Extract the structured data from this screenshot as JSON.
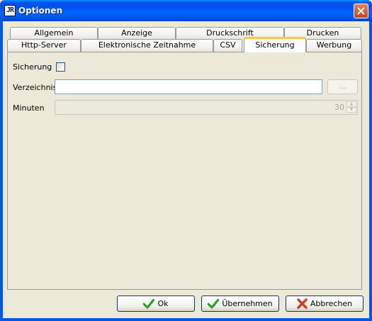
{
  "window": {
    "title": "Optionen",
    "app_icon": "JR"
  },
  "tabs_row1": [
    {
      "label": "Allgemein"
    },
    {
      "label": "Anzeige"
    },
    {
      "label": "Druckschrift"
    },
    {
      "label": "Drucken"
    }
  ],
  "tabs_row2": [
    {
      "label": "Http-Server"
    },
    {
      "label": "Elektronische Zeitnahme"
    },
    {
      "label": "CSV"
    },
    {
      "label": "Sicherung"
    },
    {
      "label": "Werbung"
    }
  ],
  "active_tab": "Sicherung",
  "form": {
    "sicherung_label": "Sicherung",
    "sicherung_checked": false,
    "verzeichnis_label": "Verzeichnis",
    "verzeichnis_value": "",
    "browse_label": "...",
    "minuten_label": "Minuten",
    "minuten_value": "30"
  },
  "buttons": {
    "ok": "Ok",
    "apply": "Übernehmen",
    "cancel": "Abbrechen"
  },
  "colors": {
    "accent_check": "#21a121",
    "cancel_x": "#d83c1e",
    "active_tab_highlight": "#ffc83c"
  }
}
